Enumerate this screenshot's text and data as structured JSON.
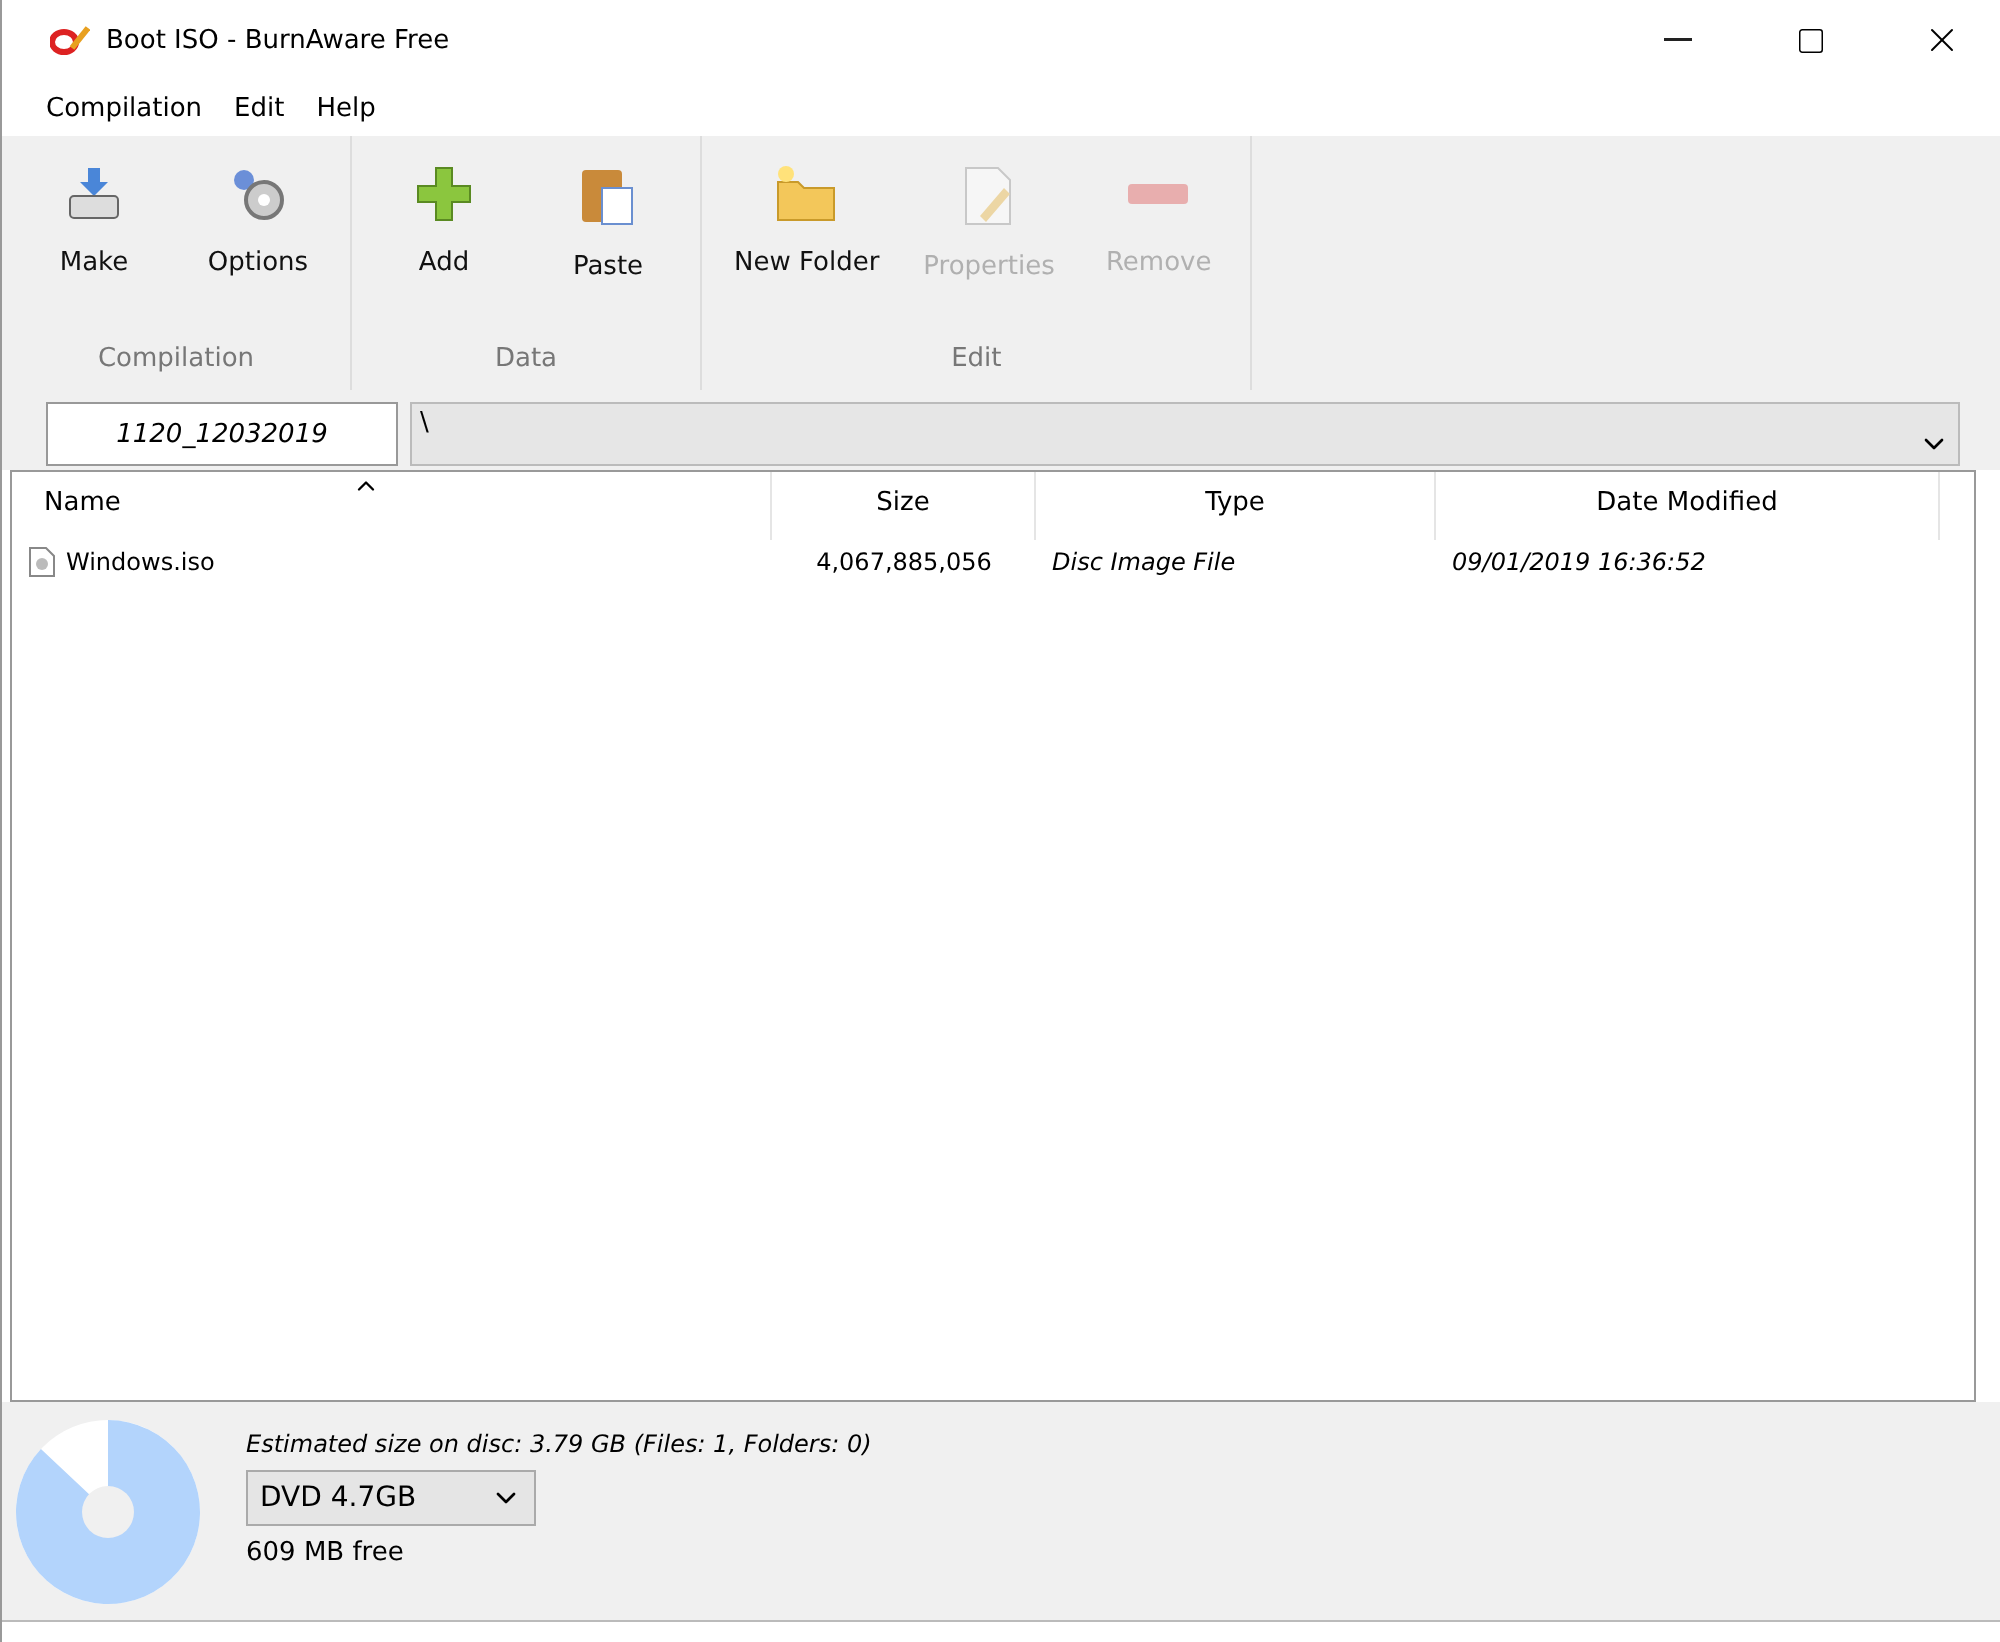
{
  "window": {
    "title": "Boot ISO - BurnAware Free"
  },
  "menu": [
    "Compilation",
    "Edit",
    "Help"
  ],
  "ribbon": [
    {
      "label": "Compilation",
      "buttons": [
        {
          "label": "Make",
          "kind": "make",
          "disabled": false
        },
        {
          "label": "Options",
          "kind": "options",
          "disabled": false
        }
      ]
    },
    {
      "label": "Data",
      "buttons": [
        {
          "label": "Add",
          "kind": "add",
          "disabled": false
        },
        {
          "label": "Paste",
          "kind": "paste",
          "disabled": false
        }
      ]
    },
    {
      "label": "Edit",
      "buttons": [
        {
          "label": "New Folder",
          "kind": "folder",
          "disabled": false
        },
        {
          "label": "Properties",
          "kind": "properties",
          "disabled": true
        },
        {
          "label": "Remove",
          "kind": "remove",
          "disabled": true
        }
      ]
    }
  ],
  "disc_label": {
    "value": "1120_12032019"
  },
  "path": {
    "value": "\\"
  },
  "table": {
    "columns": [
      "Name",
      "Size",
      "Type",
      "Date Modified"
    ],
    "rows": [
      {
        "name": "Windows.iso",
        "size": "4,067,885,056",
        "type": "Disc Image File",
        "date": "09/01/2019 16:36:52"
      }
    ]
  },
  "status": {
    "estimate": "Estimated size on disc: 3.79 GB (Files: 1, Folders: 0)",
    "disc_type": "DVD 4.7GB",
    "free": "609 MB free"
  }
}
